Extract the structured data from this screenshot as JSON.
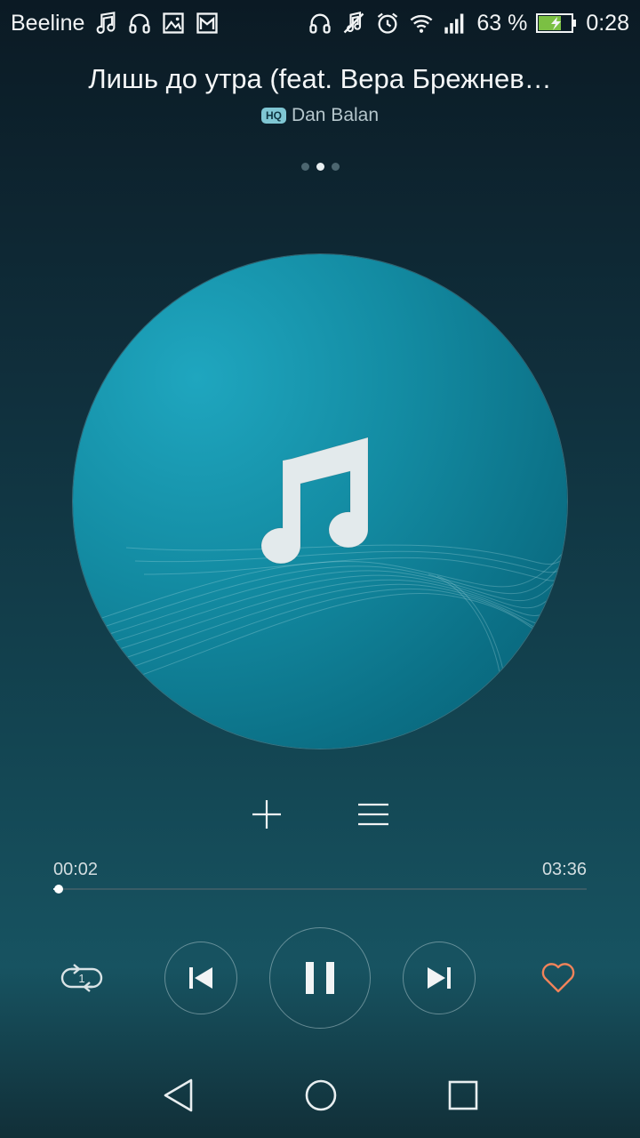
{
  "status_bar": {
    "carrier": "Beeline",
    "battery_percent": "63 %",
    "time": "0:28",
    "icons_left": [
      "music-note-icon",
      "headphones-icon",
      "image-icon",
      "mail-icon"
    ],
    "icons_right": [
      "headphones-icon",
      "mute-icon",
      "alarm-icon",
      "wifi-icon",
      "signal-icon",
      "battery-charging-icon"
    ]
  },
  "track": {
    "title": "Лишь до утра (feat. Вера Брежнев…",
    "quality_badge": "HQ",
    "artist": "Dan Balan"
  },
  "pager": {
    "pages": 3,
    "active_index": 1
  },
  "progress": {
    "elapsed": "00:02",
    "duration": "03:36",
    "fraction": 0.01
  },
  "controls": {
    "repeat_mode": "repeat-one",
    "repeat_badge": "1",
    "playing": true,
    "favorite": false
  },
  "colors": {
    "accent_heart": "#f0835a",
    "album_teal": "#138ba2",
    "background_top": "#0b1a24",
    "background_bottom": "#175361"
  }
}
